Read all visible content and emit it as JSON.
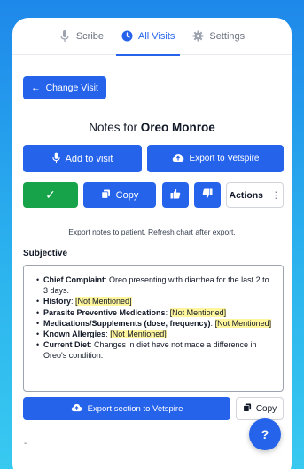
{
  "tabs": [
    {
      "label": "Scribe",
      "icon": "microphone-icon"
    },
    {
      "label": "All Visits",
      "icon": "clock-icon"
    },
    {
      "label": "Settings",
      "icon": "gear-icon"
    }
  ],
  "active_tab": "All Visits",
  "change_visit": {
    "label": "Change Visit",
    "icon": "arrow-left-icon"
  },
  "notes_title": {
    "prefix": "Notes for",
    "name": "Oreo Monroe"
  },
  "buttons": {
    "add_to_visit": "Add to visit",
    "export_vetspire": "Export to Vetspire",
    "check": "✓",
    "copy": "Copy",
    "actions": "Actions",
    "actions_more": "⋮",
    "export_section": "Export section to Vetspire",
    "copy_small": "Copy",
    "help": "?"
  },
  "hint": "Export notes to patient. Refresh chart after export.",
  "section": {
    "title": "Subjective",
    "items": [
      {
        "label": "Chief Complaint",
        "value": "Oreo presenting with diarrhea for the last 2 to 3 days.",
        "highlight": false
      },
      {
        "label": "History",
        "value": "[Not Mentioned]",
        "highlight": true
      },
      {
        "label": "Parasite Preventive Medications",
        "value": "[Not Mentioned]",
        "highlight": true
      },
      {
        "label": "Medications/Supplements (dose, frequency)",
        "value": "[Not Mentioned]",
        "highlight": true
      },
      {
        "label": "Known Allergies",
        "value": "[Not Mentioned]",
        "highlight": true
      },
      {
        "label": "Current Diet",
        "value": "Changes in diet have not made a difference in Oreo's condition.",
        "highlight": false
      }
    ]
  },
  "footer_dash": "-",
  "colors": {
    "primary": "#2563eb",
    "success": "#16a34a",
    "highlight": "#fff59d"
  }
}
